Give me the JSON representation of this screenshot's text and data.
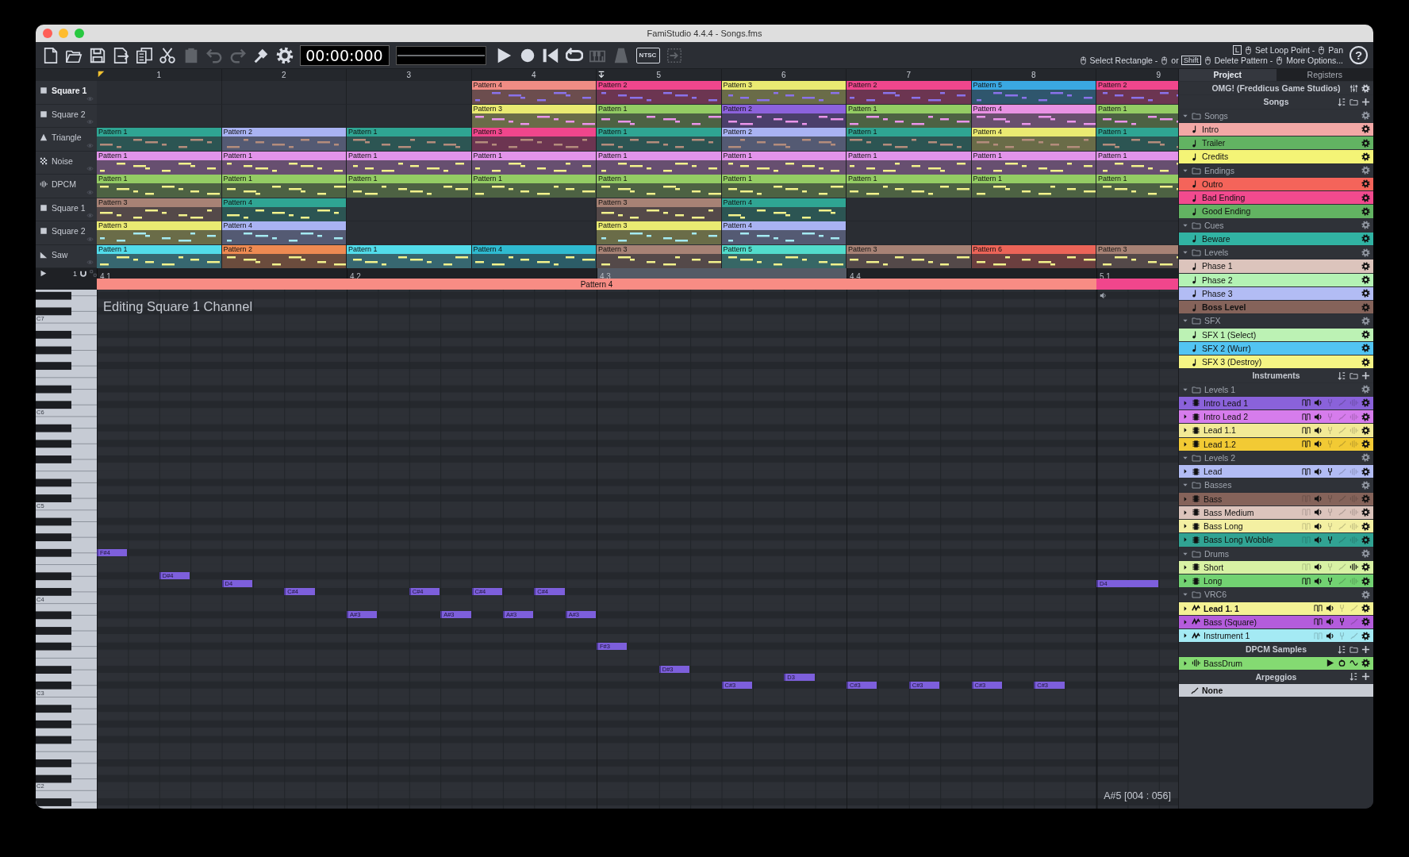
{
  "window": {
    "title": "FamiStudio 4.4.4 - Songs.fms"
  },
  "toolbar": {
    "buttons": [
      {
        "kind": "new",
        "disabled": false
      },
      {
        "kind": "open",
        "disabled": false
      },
      {
        "kind": "save",
        "disabled": false
      },
      {
        "kind": "export",
        "disabled": false
      },
      {
        "kind": "copy",
        "disabled": false
      },
      {
        "kind": "cut",
        "disabled": false
      },
      {
        "kind": "paste",
        "disabled": true
      },
      {
        "kind": "undo",
        "disabled": true
      },
      {
        "kind": "redo",
        "disabled": true
      },
      {
        "kind": "transform",
        "disabled": false
      },
      {
        "kind": "settings",
        "disabled": false
      }
    ],
    "time": "00:00:000",
    "transport": [
      {
        "kind": "play",
        "disabled": false
      },
      {
        "kind": "record",
        "disabled": false
      },
      {
        "kind": "rewind",
        "disabled": false
      },
      {
        "kind": "loop",
        "disabled": false
      },
      {
        "kind": "piano",
        "disabled": true
      },
      {
        "kind": "metronome",
        "disabled": true
      },
      {
        "kind": "machine",
        "label": "NTSC",
        "disabled": false
      },
      {
        "kind": "follow",
        "disabled": true
      }
    ],
    "help": [
      [
        {
          "kind": "key",
          "text": "L"
        },
        {
          "kind": "mouse"
        },
        {
          "kind": "text",
          "text": "Set Loop Point -"
        },
        {
          "kind": "mouse"
        },
        {
          "kind": "text",
          "text": "Pan"
        }
      ],
      [
        {
          "kind": "mouse"
        },
        {
          "kind": "text",
          "text": "Select Rectangle -"
        },
        {
          "kind": "mouse"
        },
        {
          "kind": "text",
          "text": "or"
        },
        {
          "kind": "key",
          "text": "Shift"
        },
        {
          "kind": "mouse"
        },
        {
          "kind": "text",
          "text": "Delete Pattern -"
        },
        {
          "kind": "mouse"
        },
        {
          "kind": "text",
          "text": "More Options..."
        }
      ]
    ],
    "help_button": "?"
  },
  "sequencer": {
    "columns": [
      {
        "label": "1",
        "playhead": true,
        "loop": false
      },
      {
        "label": "2",
        "playhead": false,
        "loop": false
      },
      {
        "label": "3",
        "playhead": false,
        "loop": false
      },
      {
        "label": "4",
        "playhead": false,
        "loop": false
      },
      {
        "label": "5",
        "playhead": false,
        "loop": true
      },
      {
        "label": "6",
        "playhead": false,
        "loop": false
      },
      {
        "label": "7",
        "playhead": false,
        "loop": false
      },
      {
        "label": "8",
        "playhead": false,
        "loop": false
      },
      {
        "label": "9",
        "playhead": false,
        "loop": false
      }
    ],
    "channels": [
      {
        "name": "Square 1",
        "kind": "square",
        "selected": true,
        "patterns": [
          {
            "kind": "empty"
          },
          {
            "kind": "empty"
          },
          {
            "kind": "empty"
          },
          {
            "kind": "pattern",
            "name": "Pattern 4",
            "color": "#f08c84"
          },
          {
            "kind": "pattern",
            "name": "Pattern 2",
            "color": "#f0468c"
          },
          {
            "kind": "pattern",
            "name": "Pattern 3",
            "color": "#eaea72"
          },
          {
            "kind": "pattern",
            "name": "Pattern 2",
            "color": "#f0468c"
          },
          {
            "kind": "pattern",
            "name": "Pattern 5",
            "color": "#3aa8e2"
          },
          {
            "kind": "pattern",
            "name": "Pattern 2",
            "color": "#f0468c"
          }
        ]
      },
      {
        "name": "Square 2",
        "kind": "square",
        "selected": false,
        "patterns": [
          {
            "kind": "empty"
          },
          {
            "kind": "empty"
          },
          {
            "kind": "empty"
          },
          {
            "kind": "pattern",
            "name": "Pattern 3",
            "color": "#eaea72"
          },
          {
            "kind": "pattern",
            "name": "Pattern 1",
            "color": "#94cc64"
          },
          {
            "kind": "pattern",
            "name": "Pattern 2",
            "color": "#8c62dc"
          },
          {
            "kind": "pattern",
            "name": "Pattern 1",
            "color": "#94cc64"
          },
          {
            "kind": "pattern",
            "name": "Pattern 4",
            "color": "#e892e4"
          },
          {
            "kind": "pattern",
            "name": "Pattern 1",
            "color": "#94cc64"
          }
        ]
      },
      {
        "name": "Triangle",
        "kind": "triangle",
        "selected": false,
        "patterns": [
          {
            "kind": "pattern",
            "name": "Pattern 1",
            "color": "#2fa593"
          },
          {
            "kind": "pattern",
            "name": "Pattern 2",
            "color": "#a9b3f3"
          },
          {
            "kind": "pattern",
            "name": "Pattern 1",
            "color": "#2fa593"
          },
          {
            "kind": "pattern",
            "name": "Pattern 3",
            "color": "#f0468c"
          },
          {
            "kind": "pattern",
            "name": "Pattern 1",
            "color": "#2fa593"
          },
          {
            "kind": "pattern",
            "name": "Pattern 2",
            "color": "#a9b3f3"
          },
          {
            "kind": "pattern",
            "name": "Pattern 1",
            "color": "#2fa593"
          },
          {
            "kind": "pattern",
            "name": "Pattern 4",
            "color": "#eaea72"
          },
          {
            "kind": "pattern",
            "name": "Pattern 1",
            "color": "#2fa593"
          }
        ]
      },
      {
        "name": "Noise",
        "kind": "noise",
        "selected": false,
        "patterns": [
          {
            "kind": "pattern",
            "name": "Pattern 1",
            "color": "#e294ea"
          },
          {
            "kind": "pattern",
            "name": "Pattern 1",
            "color": "#e294ea"
          },
          {
            "kind": "pattern",
            "name": "Pattern 1",
            "color": "#e294ea"
          },
          {
            "kind": "pattern",
            "name": "Pattern 1",
            "color": "#e294ea"
          },
          {
            "kind": "pattern",
            "name": "Pattern 1",
            "color": "#e294ea"
          },
          {
            "kind": "pattern",
            "name": "Pattern 1",
            "color": "#e294ea"
          },
          {
            "kind": "pattern",
            "name": "Pattern 1",
            "color": "#e294ea"
          },
          {
            "kind": "pattern",
            "name": "Pattern 1",
            "color": "#e294ea"
          },
          {
            "kind": "pattern",
            "name": "Pattern 1",
            "color": "#e294ea"
          }
        ]
      },
      {
        "name": "DPCM",
        "kind": "dpcm",
        "selected": false,
        "patterns": [
          {
            "kind": "pattern",
            "name": "Pattern 1",
            "color": "#94cc64"
          },
          {
            "kind": "pattern",
            "name": "Pattern 1",
            "color": "#94cc64"
          },
          {
            "kind": "pattern",
            "name": "Pattern 1",
            "color": "#94cc64"
          },
          {
            "kind": "pattern",
            "name": "Pattern 1",
            "color": "#94cc64"
          },
          {
            "kind": "pattern",
            "name": "Pattern 1",
            "color": "#94cc64"
          },
          {
            "kind": "pattern",
            "name": "Pattern 1",
            "color": "#94cc64"
          },
          {
            "kind": "pattern",
            "name": "Pattern 1",
            "color": "#94cc64"
          },
          {
            "kind": "pattern",
            "name": "Pattern 1",
            "color": "#94cc64"
          },
          {
            "kind": "pattern",
            "name": "Pattern 1",
            "color": "#94cc64"
          }
        ]
      },
      {
        "name": "Square 1",
        "kind": "square",
        "selected": false,
        "patterns": [
          {
            "kind": "pattern",
            "name": "Pattern 3",
            "color": "#a78275"
          },
          {
            "kind": "pattern",
            "name": "Pattern 4",
            "color": "#2fa593"
          },
          {
            "kind": "empty"
          },
          {
            "kind": "empty"
          },
          {
            "kind": "pattern",
            "name": "Pattern 3",
            "color": "#a78275"
          },
          {
            "kind": "pattern",
            "name": "Pattern 4",
            "color": "#2fa593"
          },
          {
            "kind": "empty"
          },
          {
            "kind": "empty"
          },
          {
            "kind": "empty"
          }
        ]
      },
      {
        "name": "Square 2",
        "kind": "square",
        "selected": false,
        "patterns": [
          {
            "kind": "pattern",
            "name": "Pattern 3",
            "color": "#eaea72"
          },
          {
            "kind": "pattern",
            "name": "Pattern 4",
            "color": "#a9b3f3"
          },
          {
            "kind": "empty"
          },
          {
            "kind": "empty"
          },
          {
            "kind": "pattern",
            "name": "Pattern 3",
            "color": "#eaea72"
          },
          {
            "kind": "pattern",
            "name": "Pattern 4",
            "color": "#a9b3f3"
          },
          {
            "kind": "empty"
          },
          {
            "kind": "empty"
          },
          {
            "kind": "empty"
          }
        ]
      },
      {
        "name": "Saw",
        "kind": "saw",
        "selected": false,
        "patterns": [
          {
            "kind": "pattern",
            "name": "Pattern 1",
            "color": "#52dcea"
          },
          {
            "kind": "pattern",
            "name": "Pattern 2",
            "color": "#ee8a52"
          },
          {
            "kind": "pattern",
            "name": "Pattern 1",
            "color": "#52dcea"
          },
          {
            "kind": "pattern",
            "name": "Pattern 4",
            "color": "#2fbad0"
          },
          {
            "kind": "pattern",
            "name": "Pattern 3",
            "color": "#a78275"
          },
          {
            "kind": "pattern",
            "name": "Pattern 5",
            "color": "#52dccc"
          },
          {
            "kind": "pattern",
            "name": "Pattern 3",
            "color": "#a78275"
          },
          {
            "kind": "pattern",
            "name": "Pattern 6",
            "color": "#ec6458"
          },
          {
            "kind": "pattern",
            "name": "Pattern 3",
            "color": "#a78275"
          }
        ]
      }
    ],
    "snap": "1",
    "markers": [
      {
        "label": "4.1",
        "selected": false
      },
      {
        "label": "4.2",
        "selected": false
      },
      {
        "label": "4.3",
        "selected": true
      },
      {
        "label": "4.4",
        "selected": false
      },
      {
        "label": "5.1",
        "selected": false
      }
    ],
    "pattern_bar": [
      {
        "name": "Pattern 4",
        "color": "#f88c84"
      },
      {
        "color": "#f0468c"
      }
    ]
  },
  "piano_roll": {
    "title": "Editing Square 1 Channel",
    "octaves": [
      "C7",
      "C6",
      "C5",
      "C4",
      "C3",
      "C2"
    ],
    "notes": [
      {
        "label": "F#4"
      },
      {
        "label": "D#4"
      },
      {
        "label": "D4"
      },
      {
        "label": "C#4"
      },
      {
        "label": "A#3"
      },
      {
        "label": "C#4"
      },
      {
        "label": "A#3"
      },
      {
        "label": "C#4"
      },
      {
        "label": "A#3"
      },
      {
        "label": "C#4"
      },
      {
        "label": "A#3"
      },
      {
        "label": "F#3"
      },
      {
        "label": "D#3"
      },
      {
        "label": "C#3"
      },
      {
        "label": "D3"
      },
      {
        "label": "C#3"
      },
      {
        "label": "C#3"
      },
      {
        "label": "C#3"
      },
      {
        "label": "C#3"
      },
      {
        "label": "D4"
      }
    ],
    "status": "A#5 [004 : 056]"
  },
  "project": {
    "tabs": [
      {
        "label": "Project",
        "selected": true
      },
      {
        "label": "Registers",
        "selected": false
      }
    ],
    "title": "OMG! (Freddicus Game Studios)",
    "sections": [
      {
        "title": "Songs",
        "actions": [
          {
            "kind": "sort"
          },
          {
            "kind": "folder"
          },
          {
            "kind": "add"
          }
        ],
        "children": [
          {
            "kind": "folder",
            "name": "Songs",
            "expanded": true,
            "children": [
              {
                "kind": "song",
                "name": "Intro",
                "color": "#f2a8a6",
                "selected": false
              },
              {
                "kind": "song",
                "name": "Trailer",
                "color": "#62b362",
                "selected": false
              },
              {
                "kind": "song",
                "name": "Credits",
                "color": "#f4f476",
                "selected": false
              }
            ]
          },
          {
            "kind": "folder",
            "name": "Endings",
            "expanded": true,
            "children": [
              {
                "kind": "song",
                "name": "Outro",
                "color": "#f4645a",
                "selected": false
              },
              {
                "kind": "song",
                "name": "Bad Ending",
                "color": "#f24a8e",
                "selected": false
              },
              {
                "kind": "song",
                "name": "Good Ending",
                "color": "#62b362",
                "selected": false
              }
            ]
          },
          {
            "kind": "folder",
            "name": "Cues",
            "expanded": true,
            "children": [
              {
                "kind": "song",
                "name": "Beware",
                "color": "#31b3a3",
                "selected": false
              }
            ]
          },
          {
            "kind": "folder",
            "name": "Levels",
            "expanded": true,
            "children": [
              {
                "kind": "song",
                "name": "Phase 1",
                "color": "#dcc4bc",
                "selected": false
              },
              {
                "kind": "song",
                "name": "Phase 2",
                "color": "#b4f2b4",
                "selected": false
              },
              {
                "kind": "song",
                "name": "Phase 3",
                "color": "#b2bcf4",
                "selected": false
              },
              {
                "kind": "song",
                "name": "Boss Level",
                "color": "#85635a",
                "selected": true
              }
            ]
          },
          {
            "kind": "folder",
            "name": "SFX",
            "expanded": true,
            "children": [
              {
                "kind": "song",
                "name": "SFX 1 (Select)",
                "color": "#bcf2b4",
                "selected": false
              },
              {
                "kind": "song",
                "name": "SFX 2 (Wurr)",
                "color": "#52c4f2",
                "selected": false
              },
              {
                "kind": "song",
                "name": "SFX 3 (Destroy)",
                "color": "#f4f484",
                "selected": false
              }
            ]
          }
        ]
      },
      {
        "title": "Instruments",
        "actions": [
          {
            "kind": "sort"
          },
          {
            "kind": "folder"
          },
          {
            "kind": "add"
          }
        ],
        "children": [
          {
            "kind": "folder",
            "name": "Levels 1",
            "expanded": true,
            "children": [
              {
                "kind": "instrument",
                "vrc6": false,
                "name": "Intro Lead 1",
                "color": "#8a62da",
                "selected": false,
                "expanded": false,
                "envelopes": [
                  {
                    "kind": "duty",
                    "on": true
                  },
                  {
                    "kind": "volume",
                    "on": true
                  },
                  {
                    "kind": "pitch",
                    "on": false
                  },
                  {
                    "kind": "arpeggio",
                    "on": false
                  },
                  {
                    "kind": "dpcm",
                    "on": false
                  }
                ]
              },
              {
                "kind": "instrument",
                "vrc6": false,
                "name": "Intro Lead 2",
                "color": "#d67cec",
                "selected": false,
                "expanded": false,
                "envelopes": [
                  {
                    "kind": "duty",
                    "on": true
                  },
                  {
                    "kind": "volume",
                    "on": true
                  },
                  {
                    "kind": "pitch",
                    "on": false
                  },
                  {
                    "kind": "arpeggio",
                    "on": false
                  },
                  {
                    "kind": "dpcm",
                    "on": false
                  }
                ]
              },
              {
                "kind": "instrument",
                "vrc6": false,
                "name": "Lead 1.1",
                "color": "#f2ea96",
                "selected": false,
                "expanded": false,
                "envelopes": [
                  {
                    "kind": "duty",
                    "on": true
                  },
                  {
                    "kind": "volume",
                    "on": true
                  },
                  {
                    "kind": "pitch",
                    "on": false
                  },
                  {
                    "kind": "arpeggio",
                    "on": false
                  },
                  {
                    "kind": "dpcm",
                    "on": false
                  }
                ]
              },
              {
                "kind": "instrument",
                "vrc6": false,
                "name": "Lead 1.2",
                "color": "#f2ca34",
                "selected": false,
                "expanded": false,
                "envelopes": [
                  {
                    "kind": "duty",
                    "on": true
                  },
                  {
                    "kind": "volume",
                    "on": true
                  },
                  {
                    "kind": "pitch",
                    "on": false
                  },
                  {
                    "kind": "arpeggio",
                    "on": false
                  },
                  {
                    "kind": "dpcm",
                    "on": false
                  }
                ]
              }
            ]
          },
          {
            "kind": "folder",
            "name": "Levels 2",
            "expanded": true,
            "children": [
              {
                "kind": "instrument",
                "vrc6": false,
                "name": "Lead",
                "color": "#b2bcf4",
                "selected": false,
                "expanded": false,
                "envelopes": [
                  {
                    "kind": "duty",
                    "on": true
                  },
                  {
                    "kind": "volume",
                    "on": true
                  },
                  {
                    "kind": "pitch",
                    "on": true
                  },
                  {
                    "kind": "arpeggio",
                    "on": false
                  },
                  {
                    "kind": "dpcm",
                    "on": false
                  }
                ]
              }
            ]
          },
          {
            "kind": "folder",
            "name": "Basses",
            "expanded": true,
            "children": [
              {
                "kind": "instrument",
                "vrc6": false,
                "name": "Bass",
                "color": "#85635a",
                "selected": false,
                "expanded": false,
                "envelopes": [
                  {
                    "kind": "duty",
                    "on": false
                  },
                  {
                    "kind": "volume",
                    "on": true
                  },
                  {
                    "kind": "pitch",
                    "on": false
                  },
                  {
                    "kind": "arpeggio",
                    "on": false
                  },
                  {
                    "kind": "dpcm",
                    "on": false
                  }
                ]
              },
              {
                "kind": "instrument",
                "vrc6": false,
                "name": "Bass Medium",
                "color": "#dcc4bc",
                "selected": false,
                "expanded": false,
                "envelopes": [
                  {
                    "kind": "duty",
                    "on": false
                  },
                  {
                    "kind": "volume",
                    "on": true
                  },
                  {
                    "kind": "pitch",
                    "on": false
                  },
                  {
                    "kind": "arpeggio",
                    "on": false
                  },
                  {
                    "kind": "dpcm",
                    "on": false
                  }
                ]
              },
              {
                "kind": "instrument",
                "vrc6": false,
                "name": "Bass Long",
                "color": "#f4f0a2",
                "selected": false,
                "expanded": false,
                "envelopes": [
                  {
                    "kind": "duty",
                    "on": false
                  },
                  {
                    "kind": "volume",
                    "on": true
                  },
                  {
                    "kind": "pitch",
                    "on": false
                  },
                  {
                    "kind": "arpeggio",
                    "on": false
                  },
                  {
                    "kind": "dpcm",
                    "on": false
                  }
                ]
              },
              {
                "kind": "instrument",
                "vrc6": false,
                "name": "Bass Long Wobble",
                "color": "#31a393",
                "selected": false,
                "expanded": false,
                "envelopes": [
                  {
                    "kind": "duty",
                    "on": false
                  },
                  {
                    "kind": "volume",
                    "on": true
                  },
                  {
                    "kind": "pitch",
                    "on": true
                  },
                  {
                    "kind": "arpeggio",
                    "on": false
                  },
                  {
                    "kind": "dpcm",
                    "on": false
                  }
                ]
              }
            ]
          },
          {
            "kind": "folder",
            "name": "Drums",
            "expanded": true,
            "children": [
              {
                "kind": "instrument",
                "vrc6": false,
                "name": "Short",
                "color": "#d8f2a4",
                "selected": false,
                "expanded": false,
                "envelopes": [
                  {
                    "kind": "duty",
                    "on": false
                  },
                  {
                    "kind": "volume",
                    "on": true
                  },
                  {
                    "kind": "pitch",
                    "on": false
                  },
                  {
                    "kind": "arpeggio",
                    "on": false
                  },
                  {
                    "kind": "dpcm",
                    "on": true
                  }
                ]
              },
              {
                "kind": "instrument",
                "vrc6": false,
                "name": "Long",
                "color": "#72d272",
                "selected": false,
                "expanded": false,
                "envelopes": [
                  {
                    "kind": "duty",
                    "on": true
                  },
                  {
                    "kind": "volume",
                    "on": true
                  },
                  {
                    "kind": "pitch",
                    "on": true
                  },
                  {
                    "kind": "arpeggio",
                    "on": false
                  },
                  {
                    "kind": "dpcm",
                    "on": false
                  }
                ]
              }
            ]
          },
          {
            "kind": "folder",
            "name": "VRC6",
            "expanded": true,
            "children": [
              {
                "kind": "instrument",
                "vrc6": true,
                "name": "Lead 1. 1",
                "color": "#f4f294",
                "selected": true,
                "expanded": false,
                "envelopes": [
                  {
                    "kind": "duty",
                    "on": true
                  },
                  {
                    "kind": "volume",
                    "on": true
                  },
                  {
                    "kind": "pitch",
                    "on": false
                  },
                  {
                    "kind": "arpeggio",
                    "on": false
                  }
                ]
              },
              {
                "kind": "instrument",
                "vrc6": true,
                "name": "Bass (Square)",
                "color": "#b45cdc",
                "selected": false,
                "expanded": false,
                "envelopes": [
                  {
                    "kind": "duty",
                    "on": true
                  },
                  {
                    "kind": "volume",
                    "on": true
                  },
                  {
                    "kind": "pitch",
                    "on": true
                  },
                  {
                    "kind": "arpeggio",
                    "on": false
                  }
                ]
              },
              {
                "kind": "instrument",
                "vrc6": true,
                "name": "Instrument 1",
                "color": "#a4eaf4",
                "selected": false,
                "expanded": false,
                "envelopes": [
                  {
                    "kind": "duty",
                    "on": false
                  },
                  {
                    "kind": "volume",
                    "on": true
                  },
                  {
                    "kind": "pitch",
                    "on": false
                  },
                  {
                    "kind": "arpeggio",
                    "on": false
                  }
                ]
              }
            ]
          }
        ]
      },
      {
        "title": "DPCM Samples",
        "actions": [
          {
            "kind": "sort"
          },
          {
            "kind": "folder"
          },
          {
            "kind": "add"
          }
        ],
        "children": [
          {
            "kind": "sample",
            "name": "BassDrum",
            "color": "#84da72",
            "expanded": false
          }
        ]
      },
      {
        "title": "Arpeggios",
        "actions": [
          {
            "kind": "sort"
          },
          {
            "kind": "add"
          }
        ],
        "children": [
          {
            "kind": "arpeggio",
            "name": "None",
            "color": "#c8ccd4",
            "selected": true
          }
        ]
      }
    ]
  }
}
